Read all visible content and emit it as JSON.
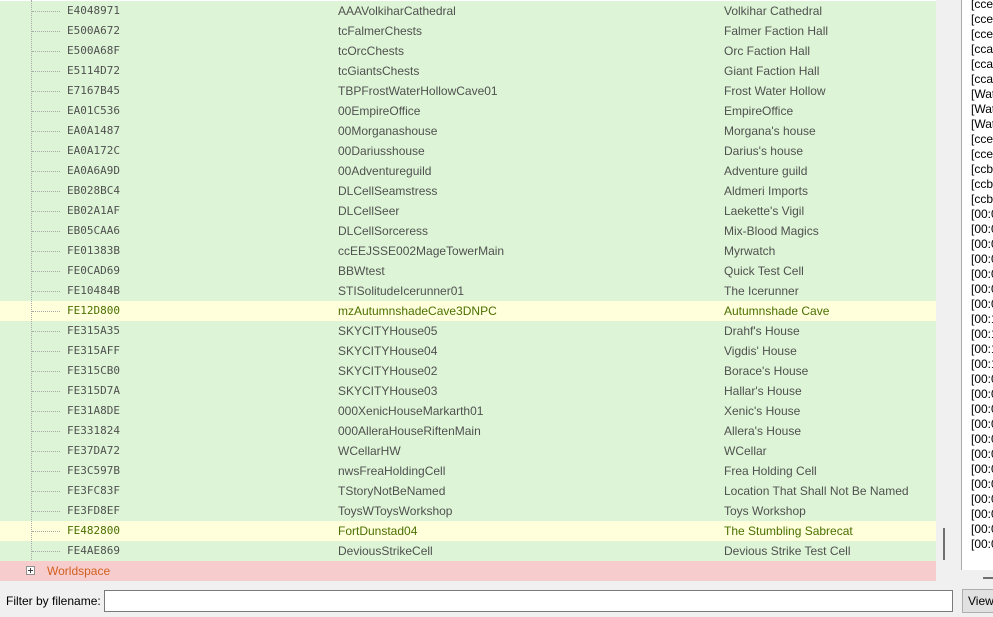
{
  "rows": [
    {
      "formid": "E4048971",
      "editor_id": "AAAVolkiharCathedral",
      "name": "Volkihar Cathedral",
      "highlight": false
    },
    {
      "formid": "E500A672",
      "editor_id": "tcFalmerChests",
      "name": "Falmer Faction Hall",
      "highlight": false
    },
    {
      "formid": "E500A68F",
      "editor_id": "tcOrcChests",
      "name": "Orc Faction Hall",
      "highlight": false
    },
    {
      "formid": "E5114D72",
      "editor_id": "tcGiantsChests",
      "name": "Giant Faction Hall",
      "highlight": false
    },
    {
      "formid": "E7167B45",
      "editor_id": "TBPFrostWaterHollowCave01",
      "name": "Frost Water Hollow",
      "highlight": false
    },
    {
      "formid": "EA01C536",
      "editor_id": "00EmpireOffice",
      "name": "EmpireOffice",
      "highlight": false
    },
    {
      "formid": "EA0A1487",
      "editor_id": "00Morganashouse",
      "name": "Morgana's house",
      "highlight": false
    },
    {
      "formid": "EA0A172C",
      "editor_id": "00Dariusshouse",
      "name": "Darius's house",
      "highlight": false
    },
    {
      "formid": "EA0A6A9D",
      "editor_id": "00Adventureguild",
      "name": "Adventure guild",
      "highlight": false
    },
    {
      "formid": "EB028BC4",
      "editor_id": "DLCellSeamstress",
      "name": "Aldmeri Imports",
      "highlight": false
    },
    {
      "formid": "EB02A1AF",
      "editor_id": "DLCellSeer",
      "name": "Laekette's Vigil",
      "highlight": false
    },
    {
      "formid": "EB05CAA6",
      "editor_id": "DLCellSorceress",
      "name": "Mix-Blood Magics",
      "highlight": false
    },
    {
      "formid": "FE01383B",
      "editor_id": "ccEEJSSE002MageTowerMain",
      "name": "Myrwatch",
      "highlight": false
    },
    {
      "formid": "FE0CAD69",
      "editor_id": "BBWtest",
      "name": "Quick Test Cell",
      "highlight": false
    },
    {
      "formid": "FE10484B",
      "editor_id": "STISolitudeIcerunner01",
      "name": "The Icerunner",
      "highlight": false
    },
    {
      "formid": "FE12D800",
      "editor_id": "mzAutumnshadeCave3DNPC",
      "name": "Autumnshade Cave",
      "highlight": true
    },
    {
      "formid": "FE315A35",
      "editor_id": "SKYCITYHouse05",
      "name": "Drahf's House",
      "highlight": false
    },
    {
      "formid": "FE315AFF",
      "editor_id": "SKYCITYHouse04",
      "name": "Vigdis' House",
      "highlight": false
    },
    {
      "formid": "FE315CB0",
      "editor_id": "SKYCITYHouse02",
      "name": "Borace's House",
      "highlight": false
    },
    {
      "formid": "FE315D7A",
      "editor_id": "SKYCITYHouse03",
      "name": "Hallar's House",
      "highlight": false
    },
    {
      "formid": "FE31A8DE",
      "editor_id": "000XenicHouseMarkarth01",
      "name": "Xenic's House",
      "highlight": false
    },
    {
      "formid": "FE331824",
      "editor_id": "000AlleraHouseRiftenMain",
      "name": "Allera's House",
      "highlight": false
    },
    {
      "formid": "FE37DA72",
      "editor_id": "WCellarHW",
      "name": "WCellar",
      "highlight": false
    },
    {
      "formid": "FE3C597B",
      "editor_id": "nwsFreaHoldingCell",
      "name": "Frea Holding Cell",
      "highlight": false
    },
    {
      "formid": "FE3FC83F",
      "editor_id": "TStoryNotBeNamed",
      "name": "Location That Shall Not Be Named",
      "highlight": false
    },
    {
      "formid": "FE3FD8EF",
      "editor_id": "ToysWToysWorkshop",
      "name": "Toys Workshop",
      "highlight": false
    },
    {
      "formid": "FE482800",
      "editor_id": "FortDunstad04",
      "name": "The Stumbling Sabrecat",
      "highlight": true
    },
    {
      "formid": "FE4AE869",
      "editor_id": "DeviousStrikeCell",
      "name": "Devious Strike Test Cell",
      "highlight": false
    }
  ],
  "worldspace_label": "Worldspace",
  "log_lines": [
    "[cce",
    "[cce",
    "[cce",
    "[cca",
    "[cca",
    "[cca",
    "[Wat",
    "[Wat",
    "[Wat",
    "[cce",
    "[cce",
    "[ccb",
    "[ccb",
    "[ccb",
    "[00:0",
    "[00:0",
    "[00:0",
    "[00:0",
    "[00:0",
    "[00:0",
    "[00:0",
    "[00:1",
    "[00:1",
    "[00:1",
    "[00:1",
    "[00:0",
    "[00:0",
    "[00:0",
    "[00:0",
    "[00:0",
    "[00:0",
    "[00:0",
    "[00:0",
    "[00:0",
    "[00:0",
    "[00:0",
    "[00:0"
  ],
  "filter": {
    "label": "Filter by filename:",
    "value": "",
    "placeholder": ""
  },
  "view_button_label": "View",
  "colors": {
    "row_bg": "#ddf5d6",
    "highlight_bg": "#ffffdb",
    "highlight_text": "#4a7000",
    "worldspace_bg": "#f7cccc",
    "worldspace_text": "#d06020"
  }
}
